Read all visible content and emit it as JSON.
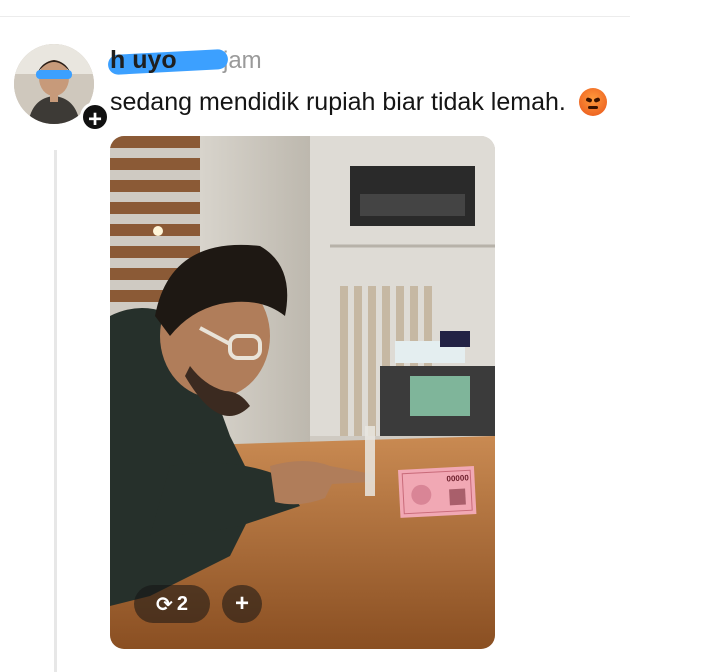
{
  "post": {
    "username": "h       uyo",
    "timestamp": "21 jam",
    "text": "sedang mendidik rupiah biar tidak lemah.",
    "emoji": "angry-face-emoji"
  },
  "follow_button": {
    "label": "+"
  },
  "photo": {
    "banknote_serial": "00000"
  },
  "media_actions": {
    "repost_count": "2",
    "add_label": "+"
  }
}
